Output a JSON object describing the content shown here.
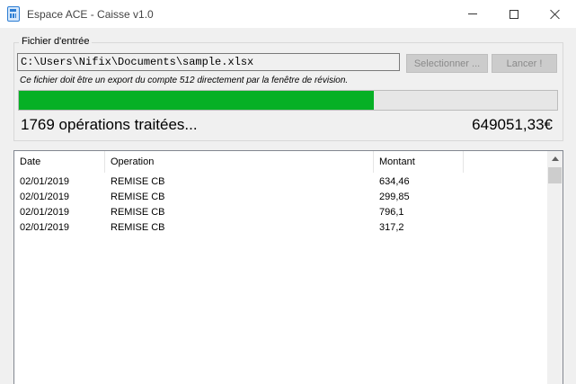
{
  "window": {
    "title": "Espace ACE - Caisse v1.0",
    "icon": "calculator-icon"
  },
  "input_group": {
    "legend": "Fichier d'entrée",
    "file_path": "C:\\Users\\Nifix\\Documents\\sample.xlsx",
    "select_button": "Selectionner ...",
    "launch_button": "Lancer !",
    "hint": "Ce fichier doit être un export du compte 512 directement par la fenêtre de révision."
  },
  "progress": {
    "fraction": 0.66,
    "color": "#06b025",
    "status_text": "1769 opérations traitées...",
    "total_text": "649051,33€"
  },
  "table": {
    "columns": [
      "Date",
      "Operation",
      "Montant"
    ],
    "rows": [
      [
        "02/01/2019",
        "REMISE CB",
        "634,46"
      ],
      [
        "02/01/2019",
        "REMISE CB",
        "299,85"
      ],
      [
        "02/01/2019",
        "REMISE CB",
        "796,1"
      ],
      [
        "02/01/2019",
        "REMISE CB",
        "317,2"
      ]
    ]
  }
}
